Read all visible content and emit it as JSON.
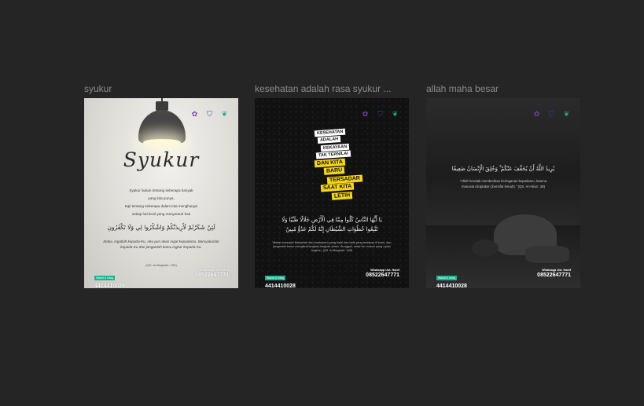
{
  "frames": [
    {
      "title": "syukur",
      "script_title": "Syukur",
      "body_lines": [
        "Syukur bukan tentang seberapa banyak",
        "yang kita punya,",
        "tapi tentang seberapa dalam kita menghargai",
        "setiap hal kecil yang menyentuh hati"
      ],
      "arabic": "لَئِنْ شَكَرْتُمْ لَأَزِيدَنَّكُمْ وَاشْكُرُوا لِي وَلَا تَكْفُرُونِ",
      "quote": "Maka, ingatlah kepada-Ku, Aku pun akan ingat kepadamu. Bersyukurlah kepada-Ku dan janganlah kamu ingkar kepada-Ku.",
      "reference": "(QS. Al-Baqarah: 152)",
      "badge": "Wakaf & Infaq",
      "left_number": "4414410028",
      "whatsapp_label": "Whatsapp Ust. Hanif",
      "whatsapp_number": "08522647771"
    },
    {
      "title": "kesehatan adalah rasa syukur ...",
      "labels": [
        "KESEHATAN",
        "ADALAH",
        "KEKAYAAN",
        "TAK TERNILAI",
        "DAN KITA",
        "BARU",
        "TERSADAR",
        "SAAT KITA",
        "LETIH"
      ],
      "arabic_1": "يَا أَيُّهَا النَّاسُ كُلُوا مِمَّا فِي الْأَرْضِ حَلَالًا طَيِّبًا وَلَا",
      "arabic_2": "تَتَّبِعُوا خُطُوَاتِ الشَّيْطَانِ إِنَّهُ لَكُمْ عَدُوٌّ مُبِينٌ",
      "translation": "Wahai manusia! Makanlah dari (makanan) yang halal dan baik yang terdapat di bumi, dan janganlah kamu mengikuti langkah-langkah setan. Sungguh, setan itu musuh yang nyata bagimu. (QS. Al-Baqarah: 168)",
      "badge": "Wakaf & Infaq",
      "left_number": "4414410028",
      "whatsapp_label": "Whatsapp Ust. Hanif",
      "whatsapp_number": "08522647771"
    },
    {
      "title": "allah maha besar",
      "arabic": "يُرِيدُ اللَّهُ أَنْ يُخَفِّفَ عَنْكُمْ ۚ وَخُلِقَ الْإِنْسَانُ ضَعِيفًا",
      "translation": "\"Allah hendak memberikan keringanan kepadamu, karena manusia diciptakan (bersifat lemah).\" (QS. An-Nisa': 28)",
      "badge": "Wakaf & Infaq",
      "left_number": "4414410028",
      "whatsapp_label": "Whatsapp Ust. Hanif",
      "whatsapp_number": "08522647771"
    }
  ],
  "logo_icons": [
    "purple-emblem-icon",
    "blue-crest-icon",
    "green-leaf-icon"
  ],
  "colors": {
    "canvas_bg": "#252525",
    "frame_title": "#8b8b8b",
    "badge": "#1ab394",
    "accent_yellow": "#f7d51d"
  }
}
